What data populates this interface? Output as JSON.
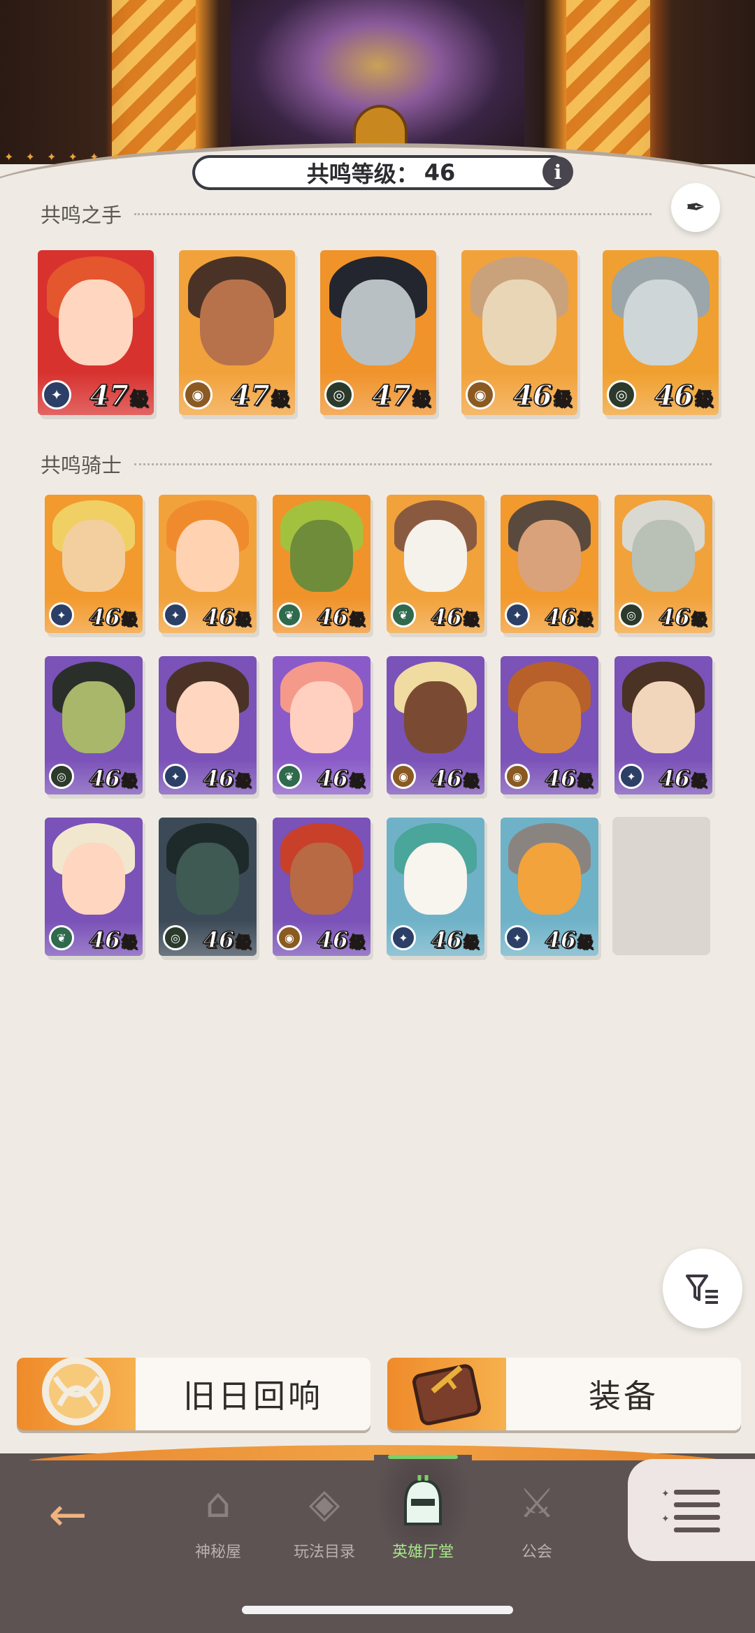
{
  "header": {
    "resonance_label": "共鸣等级：",
    "resonance_level": "46",
    "info_icon": "info-icon"
  },
  "sections": {
    "hands_title": "共鸣之手",
    "knights_title": "共鸣骑士"
  },
  "level_unit": "级",
  "hands": [
    {
      "level": "47",
      "class_icon": "star-compass-icon",
      "bg": "#d8322f",
      "face": "#ffd6bf",
      "hair": "#e4562d",
      "badge": "#2c3f66"
    },
    {
      "level": "47",
      "class_icon": "gem-icon",
      "bg": "#f2a23b",
      "face": "#b7724c",
      "hair": "#4a3326",
      "badge": "#8a5a22"
    },
    {
      "level": "47",
      "class_icon": "eye-icon",
      "bg": "#f0932b",
      "face": "#b9c0c4",
      "hair": "#23262e",
      "badge": "#2b3a2b"
    },
    {
      "level": "46",
      "class_icon": "gem-icon",
      "bg": "#f2a23b",
      "face": "#e9d6b6",
      "hair": "#c9a27c",
      "badge": "#8a5a22"
    },
    {
      "level": "46",
      "class_icon": "eye-icon",
      "bg": "#f0a030",
      "face": "#cfd6d8",
      "hair": "#9aa6a9",
      "badge": "#2b3a2b"
    }
  ],
  "knights": [
    {
      "level": "46",
      "class_icon": "star-compass-icon",
      "bg": "#f29a2e",
      "face": "#f3cf9f",
      "hair": "#f0d064",
      "badge": "#2c3f66"
    },
    {
      "level": "46",
      "class_icon": "star-compass-icon",
      "bg": "#f2a23b",
      "face": "#ffd3b2",
      "hair": "#f08b2d",
      "badge": "#2c3f66"
    },
    {
      "level": "46",
      "class_icon": "leaf-icon",
      "bg": "#f0932b",
      "face": "#6f8c3a",
      "hair": "#a2c23f",
      "badge": "#2f6a4d"
    },
    {
      "level": "46",
      "class_icon": "leaf-icon",
      "bg": "#f2a23b",
      "face": "#f5f2ec",
      "hair": "#8a5a40",
      "badge": "#2f6a4d"
    },
    {
      "level": "46",
      "class_icon": "star-compass-icon",
      "bg": "#f29a2e",
      "face": "#d9a27a",
      "hair": "#5a4a3e",
      "badge": "#2c3f66"
    },
    {
      "level": "46",
      "class_icon": "eye-icon",
      "bg": "#f2a23b",
      "face": "#b9c0b6",
      "hair": "#d9d9d2",
      "badge": "#2b3a2b"
    },
    {
      "level": "46",
      "class_icon": "eye-icon",
      "bg": "#7a52b8",
      "face": "#a8b76a",
      "hair": "#2b2f2a",
      "badge": "#2b3a2b"
    },
    {
      "level": "46",
      "class_icon": "star-compass-icon",
      "bg": "#7a52b8",
      "face": "#ffd6bf",
      "hair": "#4a3326",
      "badge": "#2c3f66"
    },
    {
      "level": "46",
      "class_icon": "leaf-icon",
      "bg": "#8a5bc8",
      "face": "#ffcfc0",
      "hair": "#f59a8a",
      "badge": "#2f6a4d"
    },
    {
      "level": "46",
      "class_icon": "gem-icon",
      "bg": "#7a52b8",
      "face": "#7a4a32",
      "hair": "#f0dba0",
      "badge": "#8a5a22"
    },
    {
      "level": "46",
      "class_icon": "gem-icon",
      "bg": "#7a52b8",
      "face": "#d9883a",
      "hair": "#b8602a",
      "badge": "#8a5a22"
    },
    {
      "level": "46",
      "class_icon": "star-compass-icon",
      "bg": "#7a52b8",
      "face": "#f1d6bc",
      "hair": "#4a3224",
      "badge": "#2c3f66"
    },
    {
      "level": "46",
      "class_icon": "leaf-icon",
      "bg": "#7a52b8",
      "face": "#ffd6bf",
      "hair": "#f1e7cf",
      "badge": "#2f6a4d"
    },
    {
      "level": "46",
      "class_icon": "eye-icon",
      "bg": "#3c4a58",
      "face": "#3e5a52",
      "hair": "#1e2a2a",
      "badge": "#2b3a2b"
    },
    {
      "level": "46",
      "class_icon": "gem-icon",
      "bg": "#7a52b8",
      "face": "#b86a44",
      "hair": "#c9402a",
      "badge": "#8a5a22"
    },
    {
      "level": "46",
      "class_icon": "star-compass-icon",
      "bg": "#6fb2c8",
      "face": "#f8f4ee",
      "hair": "#4aa59a",
      "badge": "#2c3f66"
    },
    {
      "level": "46",
      "class_icon": "star-compass-icon",
      "bg": "#6fb2c8",
      "face": "#f2a33c",
      "hair": "#8a8480",
      "badge": "#2c3f66"
    }
  ],
  "buttons": {
    "echo_label": "旧日回响",
    "equipment_label": "装备",
    "filter_icon": "filter-icon",
    "feather_icon": "feather-icon"
  },
  "nav": {
    "back_icon": "back-arrow-icon",
    "tabs": [
      {
        "label": "神秘屋",
        "icon": "mystery-house-icon"
      },
      {
        "label": "玩法目录",
        "icon": "diamond-grid-icon"
      },
      {
        "label": "英雄厅堂",
        "icon": "knight-helmet-icon"
      },
      {
        "label": "公会",
        "icon": "crossed-swords-icon"
      }
    ],
    "menu_icon": "menu-list-icon"
  },
  "colors": {
    "accent_orange": "#ef8a2a",
    "active_tab": "#a6e88a",
    "nav_bg": "#5e5353"
  }
}
